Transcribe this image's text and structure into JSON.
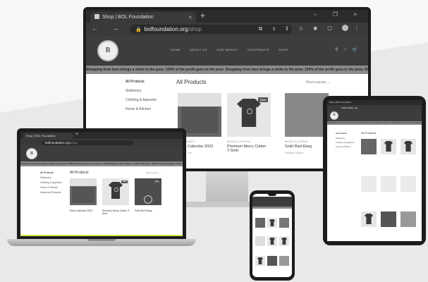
{
  "browser": {
    "tab_title": "Shop | BOL Foundation",
    "tab_close": "×",
    "new_tab": "+",
    "window_controls": "– ❐ ×",
    "nav_icons": "← → C",
    "url_domain": "bolfoundation.org",
    "url_path": "/shop",
    "lock_icon": "🔒",
    "toolbar_icons": "⧉ ⚲ ⇪ ☆ ✱ ▢",
    "menu_icon": "⋮"
  },
  "site": {
    "logo_text": "B",
    "menu_items": [
      "HOME",
      "ABOUT US",
      "OUR IMPACT",
      "CONTRIBUTE",
      "SHOP"
    ],
    "header_icons": "⚲ ♀ 🛒",
    "marquee": "Shopping from here brings a smile to the poor. 100% of the profit goes to the poor.     Shopping from here brings a smile to the poor. 100% of the profit goes to the poor.     Shopping from here brings a smile to the poor.",
    "categories": [
      "All Products",
      "Stationery",
      "Clothing & Apparels",
      "Home & Kitchen",
      "Seasonal Products"
    ],
    "all_products_heading": "All Products",
    "sort_label": "Most popular ⌄",
    "products": [
      {
        "category": "STATIONERY",
        "name": "Desk Calendar 2023",
        "subtitle": "Fighter Tee"
      },
      {
        "category": "MENS CLOTHING",
        "name": "Premium Merry Cotton T-Shirt",
        "badge": "Sale"
      },
      {
        "category": "MENS CLOTHING",
        "name": "Solid Red Elarg",
        "subtitle": "Holiday Edition",
        "badge": "Sale"
      }
    ],
    "laptop_product_names": [
      "Desk Calendar 2023",
      "Premium Merry Cotton T-Shirt",
      "Solid Red Elarg"
    ]
  },
  "colors": {
    "device_frame": "#1c1c1c",
    "header_bg": "#3d3d3d",
    "marquee_bg": "#8a8a8a",
    "laptop_accent": "#d9e84a"
  }
}
